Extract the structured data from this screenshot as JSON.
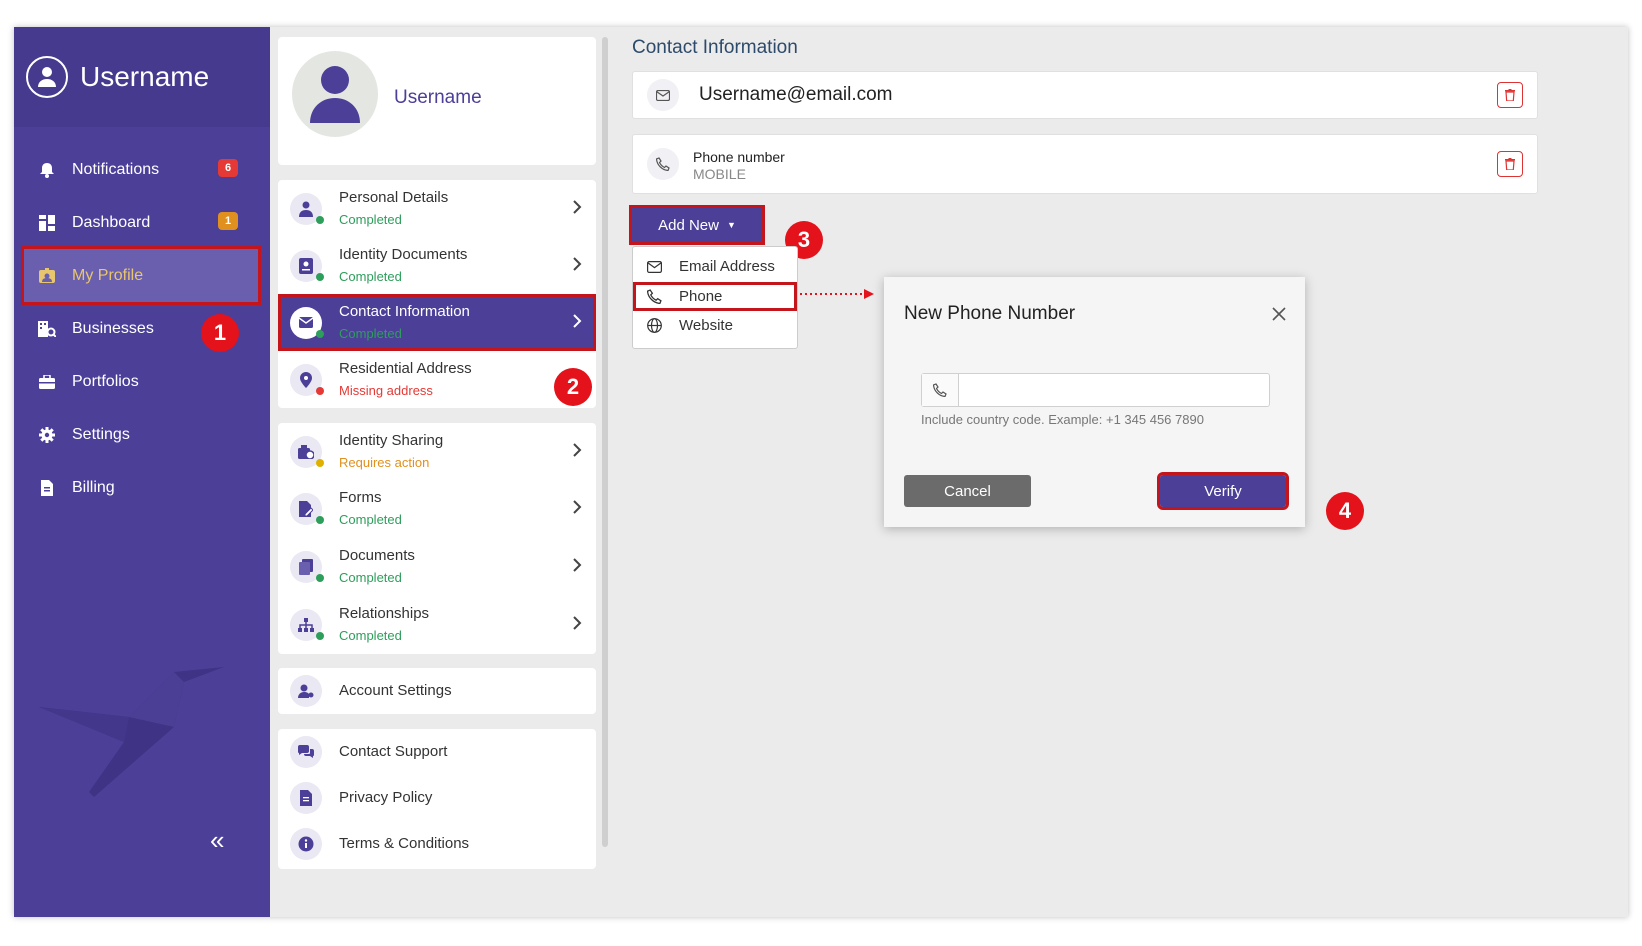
{
  "sidebar": {
    "username": "Username",
    "items": [
      {
        "label": "Notifications",
        "badge": "6",
        "badge_color": "#e53935"
      },
      {
        "label": "Dashboard",
        "badge": "1",
        "badge_color": "#e0901f"
      },
      {
        "label": "My Profile"
      },
      {
        "label": "Businesses"
      },
      {
        "label": "Portfolios"
      },
      {
        "label": "Settings"
      },
      {
        "label": "Billing"
      }
    ],
    "collapse_icon": "«"
  },
  "profile": {
    "username": "Username"
  },
  "menu_groups": {
    "group1": [
      {
        "title": "Personal Details",
        "status": "Completed",
        "status_color": "#2e9e5b"
      },
      {
        "title": "Identity Documents",
        "status": "Completed",
        "status_color": "#2e9e5b"
      },
      {
        "title": "Contact Information",
        "status": "Completed",
        "status_color": "#2e9e5b"
      },
      {
        "title": "Residential Address",
        "status": "Missing address",
        "status_color": "#e53935"
      }
    ],
    "group2": [
      {
        "title": "Identity Sharing",
        "status": "Requires action",
        "status_color": "#e0901f"
      },
      {
        "title": "Forms",
        "status": "Completed",
        "status_color": "#2e9e5b"
      },
      {
        "title": "Documents",
        "status": "Completed",
        "status_color": "#2e9e5b"
      },
      {
        "title": "Relationships",
        "status": "Completed",
        "status_color": "#2e9e5b"
      }
    ],
    "account_settings": "Account Settings",
    "support": [
      "Contact Support",
      "Privacy Policy",
      "Terms & Conditions"
    ]
  },
  "contact": {
    "heading": "Contact Information",
    "email": "Username@email.com",
    "phone_label": "Phone number",
    "phone_type": "MOBILE",
    "add_new": "Add New",
    "dropdown": [
      "Email Address",
      "Phone",
      "Website"
    ]
  },
  "modal": {
    "title": "New Phone Number",
    "input_value": "",
    "hint": "Include country code. Example: +1 345 456 7890",
    "cancel": "Cancel",
    "verify": "Verify"
  },
  "markers": [
    "1",
    "2",
    "3",
    "4"
  ],
  "colors": {
    "brand": "#4b3f98",
    "highlight": "#c4151c"
  }
}
